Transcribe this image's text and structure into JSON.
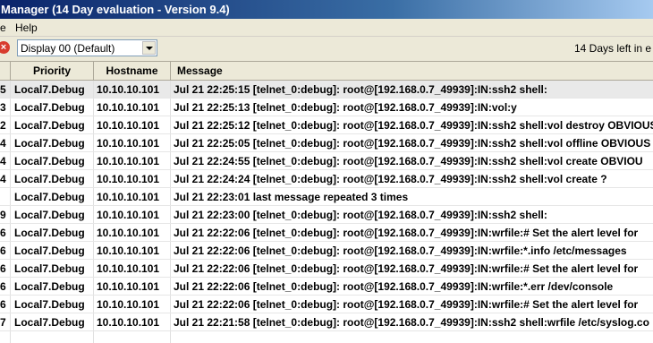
{
  "window": {
    "title": "Manager (14 Day evaluation - Version 9.4)"
  },
  "menu": {
    "items": [
      "e",
      "Help"
    ]
  },
  "toolbar": {
    "display_select": "Display 00 (Default)",
    "days_left": "14 Days left in e"
  },
  "table": {
    "columns": [
      "",
      "Priority",
      "Hostname",
      "Message"
    ],
    "rows": [
      [
        "5",
        "Local7.Debug",
        "10.10.10.101",
        "Jul 21 22:25:15 [telnet_0:debug]: root@[192.168.0.7_49939]:IN:ssh2 shell:"
      ],
      [
        "3",
        "Local7.Debug",
        "10.10.10.101",
        "Jul 21 22:25:13 [telnet_0:debug]: root@[192.168.0.7_49939]:IN:vol:y"
      ],
      [
        "2",
        "Local7.Debug",
        "10.10.10.101",
        "Jul 21 22:25:12 [telnet_0:debug]: root@[192.168.0.7_49939]:IN:ssh2 shell:vol destroy OBVIOUS"
      ],
      [
        "4",
        "Local7.Debug",
        "10.10.10.101",
        "Jul 21 22:25:05 [telnet_0:debug]: root@[192.168.0.7_49939]:IN:ssh2 shell:vol offline OBVIOUS"
      ],
      [
        "4",
        "Local7.Debug",
        "10.10.10.101",
        "Jul 21 22:24:55 [telnet_0:debug]: root@[192.168.0.7_49939]:IN:ssh2 shell:vol create OBVIOU"
      ],
      [
        "4",
        "Local7.Debug",
        "10.10.10.101",
        "Jul 21 22:24:24 [telnet_0:debug]: root@[192.168.0.7_49939]:IN:ssh2 shell:vol create ?"
      ],
      [
        "",
        "Local7.Debug",
        "10.10.10.101",
        "Jul 21 22:23:01 last message repeated 3 times"
      ],
      [
        "9",
        "Local7.Debug",
        "10.10.10.101",
        "Jul 21 22:23:00 [telnet_0:debug]: root@[192.168.0.7_49939]:IN:ssh2 shell:"
      ],
      [
        "6",
        "Local7.Debug",
        "10.10.10.101",
        "Jul 21 22:22:06 [telnet_0:debug]: root@[192.168.0.7_49939]:IN:wrfile:# Set the alert level for"
      ],
      [
        "6",
        "Local7.Debug",
        "10.10.10.101",
        "Jul 21 22:22:06 [telnet_0:debug]: root@[192.168.0.7_49939]:IN:wrfile:*.info /etc/messages"
      ],
      [
        "6",
        "Local7.Debug",
        "10.10.10.101",
        "Jul 21 22:22:06 [telnet_0:debug]: root@[192.168.0.7_49939]:IN:wrfile:# Set the alert level for"
      ],
      [
        "6",
        "Local7.Debug",
        "10.10.10.101",
        "Jul 21 22:22:06 [telnet_0:debug]: root@[192.168.0.7_49939]:IN:wrfile:*.err /dev/console"
      ],
      [
        "6",
        "Local7.Debug",
        "10.10.10.101",
        "Jul 21 22:22:06 [telnet_0:debug]: root@[192.168.0.7_49939]:IN:wrfile:# Set the alert level for"
      ],
      [
        "7",
        "Local7.Debug",
        "10.10.10.101",
        "Jul 21 22:21:58 [telnet_0:debug]: root@[192.168.0.7_49939]:IN:ssh2 shell:wrfile /etc/syslog.co"
      ]
    ]
  },
  "colors": {
    "selected_row": "#e9e9e9",
    "chrome": "#ece9d8",
    "title_start": "#0a246a"
  }
}
